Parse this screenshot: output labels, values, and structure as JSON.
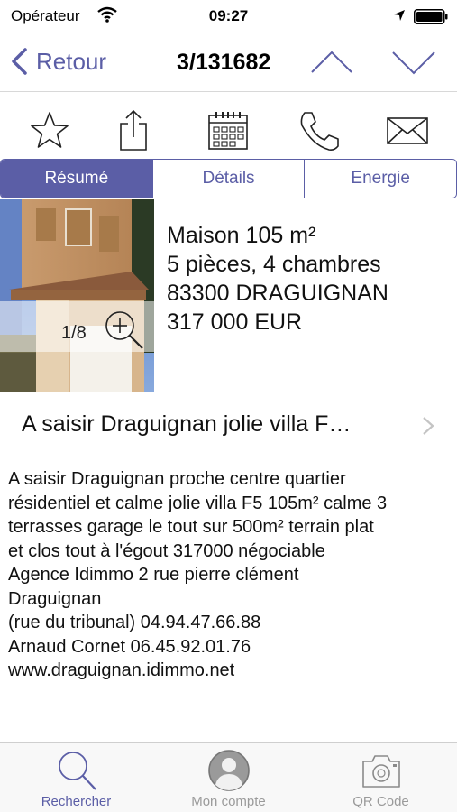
{
  "status_bar": {
    "carrier": "Opérateur",
    "time": "09:27"
  },
  "nav": {
    "back_label": "Retour",
    "title": "3/131682"
  },
  "actions": [
    {
      "name": "favorite",
      "icon": "star-icon"
    },
    {
      "name": "share",
      "icon": "share-icon"
    },
    {
      "name": "calendar",
      "icon": "calendar-icon"
    },
    {
      "name": "call",
      "icon": "phone-icon"
    },
    {
      "name": "email",
      "icon": "envelope-icon"
    }
  ],
  "tabs_segment": {
    "items": [
      "Résumé",
      "Détails",
      "Energie"
    ],
    "selected": "Résumé"
  },
  "listing": {
    "photo_counter": "1/8",
    "type_surface": "Maison 105 m²",
    "rooms": "5 pièces, 4 chambres",
    "location": "83300 DRAGUIGNAN",
    "price": "317 000  EUR",
    "headline": "A saisir Draguignan jolie villa F…",
    "description": "A saisir Draguignan proche centre quartier\nrésidentiel et calme jolie villa F5 105m² calme 3\nterrasses garage le tout sur 500m² terrain plat\net clos tout à l'égout  317000 négociable\nAgence Idimmo 2 rue pierre clément\nDraguignan\n(rue du tribunal) 04.94.47.66.88\nArnaud Cornet  06.45.92.01.76\nwww.draguignan.idimmo.net"
  },
  "tab_bar": {
    "items": [
      {
        "label": "Rechercher",
        "icon": "search-icon",
        "active": true
      },
      {
        "label": "Mon compte",
        "icon": "user-icon",
        "active": false
      },
      {
        "label": "QR Code",
        "icon": "camera-icon",
        "active": false
      }
    ]
  },
  "colors": {
    "accent": "#5b5ea6",
    "inactive": "#9a9a9a"
  }
}
